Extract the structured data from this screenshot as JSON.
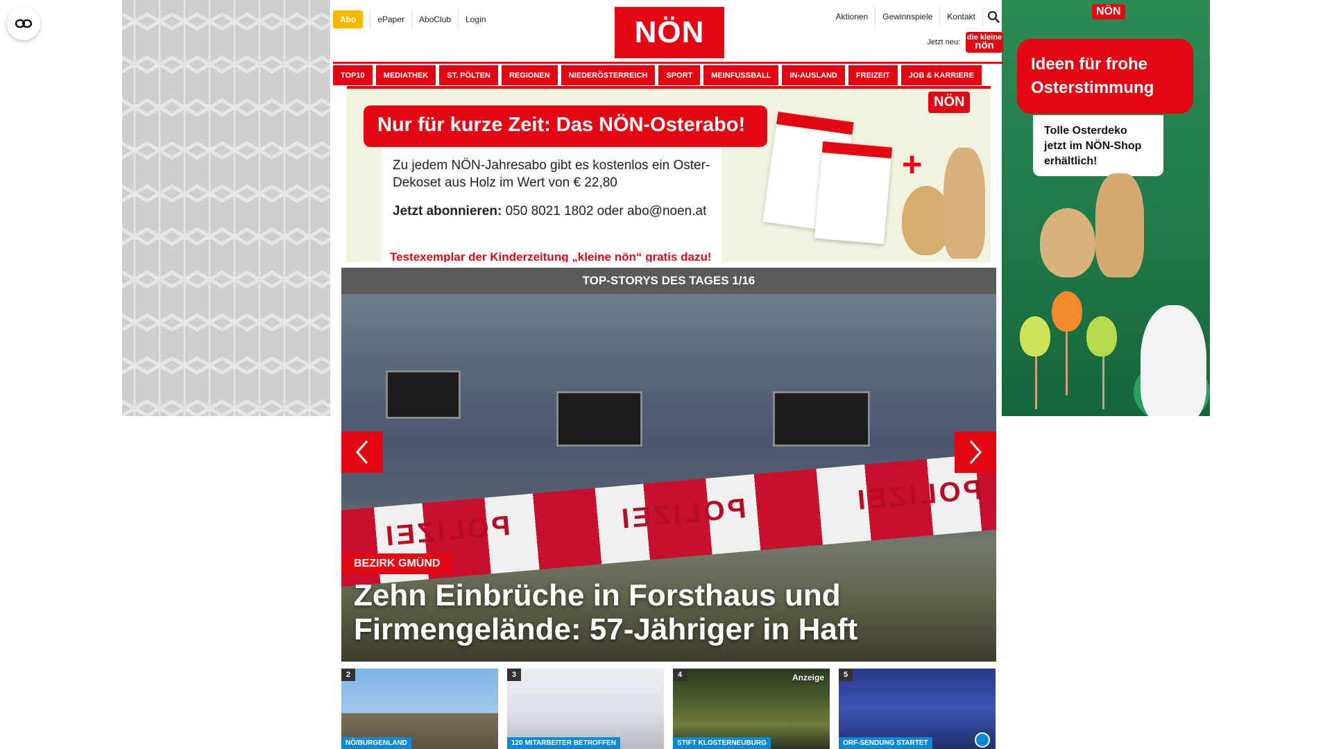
{
  "accessibility": {
    "icon": "eye-icon"
  },
  "topbar": {
    "abo": "Abo",
    "links_left": [
      "ePaper",
      "AboClub",
      "Login"
    ],
    "logo": "NÖN",
    "links_right": [
      "Aktionen",
      "Gewinnspiele",
      "Kontakt"
    ],
    "jetzt_neu": "Jetzt neu:",
    "kleine_noen_top": "die kleine",
    "kleine_noen_bottom": "nön"
  },
  "nav": [
    "TOP10",
    "MEDIATHEK",
    "ST. PÖLTEN",
    "REGIONEN",
    "NIEDERÖSTERREICH",
    "SPORT",
    "MEINFUSSBALL",
    "IN-AUSLAND",
    "FREIZEIT",
    "JOB & KARRIERE"
  ],
  "promo": {
    "headline": "Nur für kurze Zeit: Das NÖN-Osterabo!",
    "text1": "Zu jedem NÖN-Jahresabo gibt es kostenlos ein Oster-Dekoset aus Holz im Wert von € 22,80",
    "cta_bold": "Jetzt abonnieren:",
    "cta_rest": " 050 8021 1802 oder abo@noen.at",
    "red_line": "Testexemplar der Kinderzeitung „kleine nön“ gratis dazu!",
    "brand": "NÖN"
  },
  "side_ad_right": {
    "brand": "NÖN",
    "headline": "Ideen für frohe Osterstimmung",
    "note": "Tolle Osterdeko jetzt im NÖN-Shop erhältlich!"
  },
  "stories": {
    "header": "TOP-STORYS DES TAGES 1/16",
    "category": "BEZIRK GMÜND",
    "headline": "Zehn Einbrüche in Forsthaus und Firmengelände: 57-Jähriger in Haft",
    "tape_text": "POLIZEI"
  },
  "thumbs": [
    {
      "num": "2",
      "label": "NÖ/BURGENLAND",
      "tag": ""
    },
    {
      "num": "3",
      "label": "120 MITARBEITER BETROFFEN",
      "tag": ""
    },
    {
      "num": "4",
      "label": "STIFT KLOSTERNEUBURG",
      "tag": "Anzeige"
    },
    {
      "num": "5",
      "label": "ORF-SENDUNG STARTET",
      "tag": ""
    }
  ]
}
